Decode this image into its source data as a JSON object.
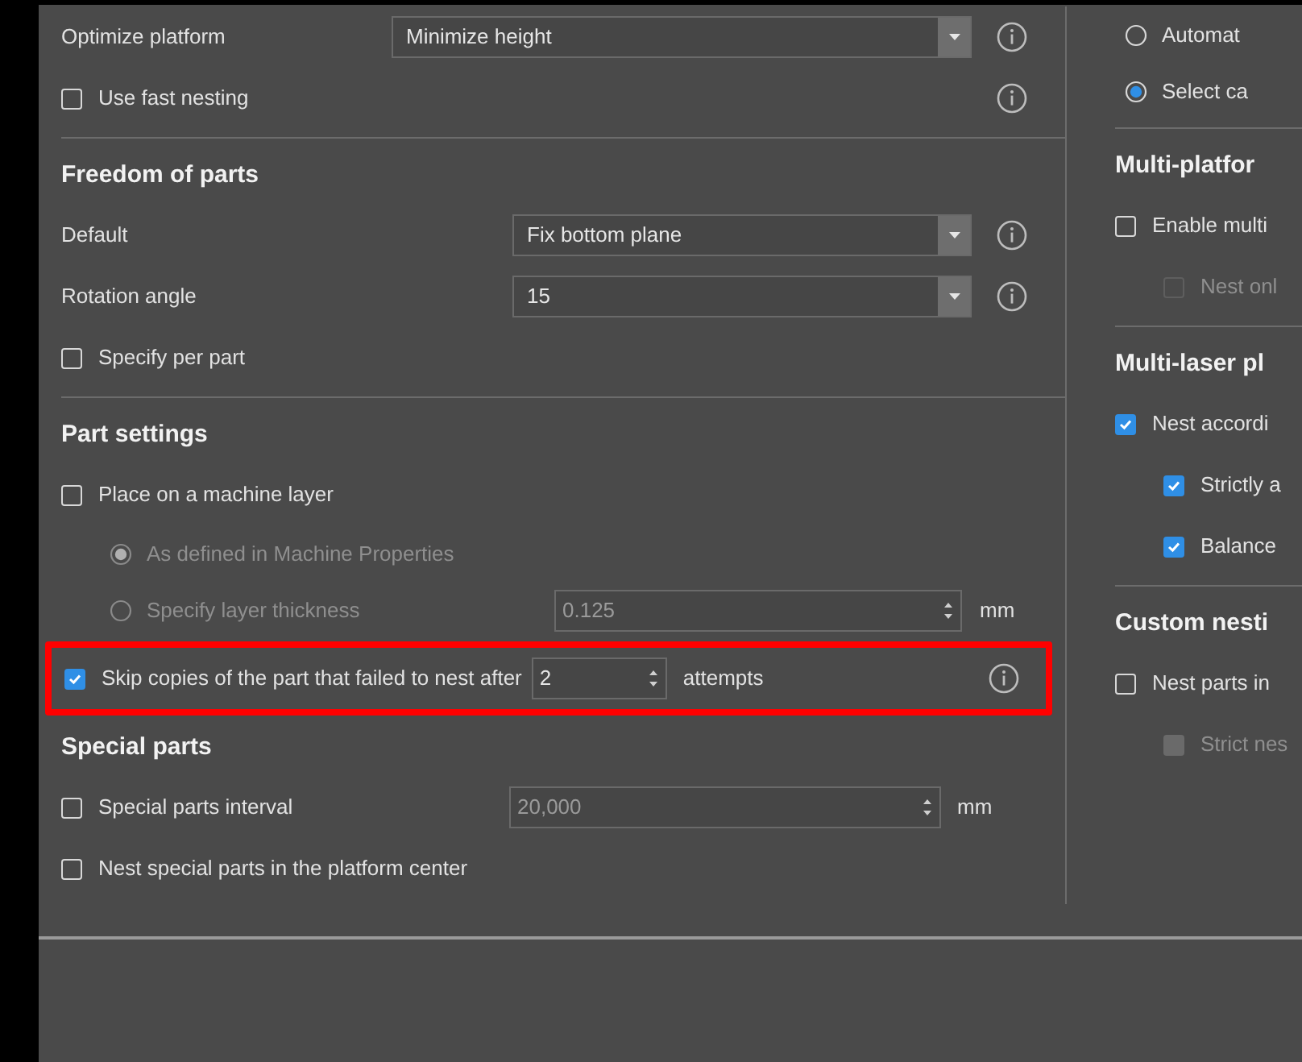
{
  "left": [
    {
      "rows": [
        {
          "kind": "select",
          "label": "Optimize platform",
          "value": "Minimize height",
          "info": true
        },
        {
          "kind": "checkbox",
          "label": "Use fast nesting",
          "checked": false,
          "disabled": false,
          "indent": false,
          "info": true
        }
      ]
    },
    {
      "heading": "Freedom of parts",
      "rows": [
        {
          "kind": "select",
          "label": "Default",
          "value": "Fix bottom plane",
          "info": true
        },
        {
          "kind": "select",
          "label": "Rotation angle",
          "value": "15",
          "info": true
        },
        {
          "kind": "checkbox",
          "label": "Specify per part",
          "checked": false,
          "disabled": false,
          "indent": false,
          "info": false
        }
      ]
    },
    {
      "heading": "Part settings",
      "rows": [
        {
          "kind": "checkbox",
          "label": "Place on a machine layer",
          "checked": false,
          "disabled": false,
          "indent": false,
          "info": false
        },
        {
          "kind": "radio",
          "label": "As defined in Machine Properties",
          "selected": true,
          "disabled": true
        },
        {
          "kind": "radio",
          "label": "Specify layer thickness",
          "selected": false,
          "disabled": true,
          "value": "0.125",
          "unit": "mm"
        },
        {
          "kind": "skip",
          "label": "Skip copies of the part that failed to nest after",
          "checked": true,
          "value": "2",
          "suffix": "attempts",
          "info": true,
          "highlighted": true
        }
      ]
    },
    {
      "heading": "Special parts",
      "nodivider": true,
      "rows": [
        {
          "kind": "checkfield",
          "label": "Special parts interval",
          "checked": false,
          "value": "20,000",
          "unit": "mm"
        },
        {
          "kind": "checkbox",
          "label": "Nest special parts in the platform center",
          "checked": false,
          "disabled": false,
          "indent": false,
          "info": false
        }
      ]
    }
  ],
  "right": [
    {
      "rows": [
        {
          "kind": "radio",
          "label": "Automat",
          "selected": false,
          "disabled": false
        },
        {
          "kind": "radio",
          "label": "Select ca",
          "selected": true,
          "disabled": false
        }
      ]
    },
    {
      "heading": "Multi-platfor",
      "rows": [
        {
          "kind": "checkbox",
          "label": "Enable multi",
          "checked": false,
          "disabled": false,
          "indent": false
        },
        {
          "kind": "checkbox",
          "label": "Nest onl",
          "checked": false,
          "disabled": true,
          "indent": true
        }
      ]
    },
    {
      "heading": "Multi-laser pl",
      "rows": [
        {
          "kind": "checkbox",
          "label": "Nest accordi",
          "checked": true,
          "disabled": false,
          "indent": false
        },
        {
          "kind": "checkbox",
          "label": "Strictly a",
          "checked": true,
          "disabled": false,
          "indent": true
        },
        {
          "kind": "checkbox",
          "label": "Balance",
          "checked": true,
          "disabled": false,
          "indent": true
        }
      ]
    },
    {
      "heading": "Custom nesti",
      "rows": [
        {
          "kind": "checkbox",
          "label": "Nest parts in",
          "checked": false,
          "disabled": false,
          "indent": false
        },
        {
          "kind": "checkbox",
          "label": "Strict nes",
          "checked": true,
          "disabled": true,
          "indent": true
        }
      ]
    }
  ]
}
